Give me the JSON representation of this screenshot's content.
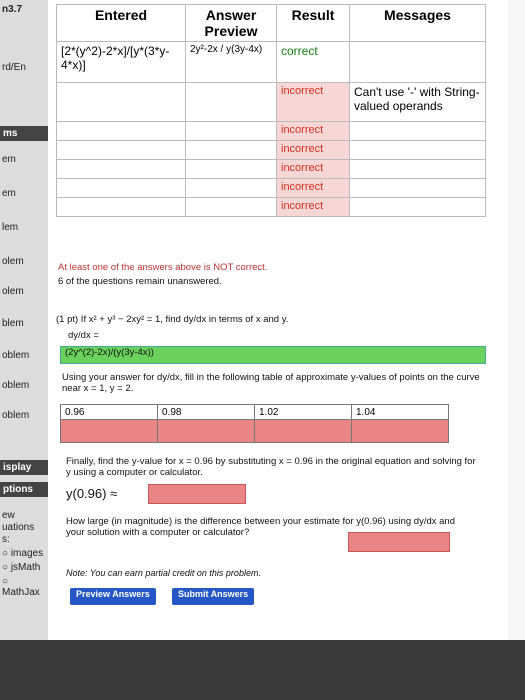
{
  "sidebar": {
    "top": "n3.7",
    "items": [
      "rd/En",
      "ms",
      "em",
      "em",
      "lem",
      "olem",
      "olem",
      "blem",
      "oblem",
      "oblem",
      "oblem"
    ],
    "display": "isplay",
    "options": "ptions",
    "misc": [
      "ew",
      "uations",
      "s:",
      "images",
      "jsMath",
      "MathJax"
    ]
  },
  "results": {
    "headers": [
      "Entered",
      "Answer Preview",
      "Result",
      "Messages"
    ],
    "row1": {
      "entered": "[2*(y^2)-2*x]/[y*(3*y-4*x)]",
      "preview": "2y²-2x / y(3y-4x)",
      "result": "correct",
      "message": ""
    },
    "row2": {
      "result": "incorrect",
      "message": "Can't use '-' with String-valued operands"
    },
    "row3": {
      "result": "incorrect"
    },
    "row4": {
      "result": "incorrect"
    },
    "row5": {
      "result": "incorrect"
    },
    "row6": {
      "result": "incorrect"
    },
    "row7": {
      "result": "incorrect"
    }
  },
  "messages": {
    "not_correct": "At least one of the answers above is NOT correct.",
    "unanswered": "6 of the questions remain unanswered."
  },
  "problem": {
    "part1": "(1 pt) If x² + y³ − 2xy² = 1, find dy/dx in terms of x and y.",
    "dydx_label": "dy/dx =",
    "answer1": "(2y^(2)-2x)/(y(3y-4x))",
    "instruction": "Using your answer for dy/dx, fill in the following table of approximate y-values of points on the curve near x = 1, y = 2.",
    "table_x": [
      "0.96",
      "0.98",
      "1.02",
      "1.04"
    ],
    "finally": "Finally, find the y-value for x = 0.96 by substituting x = 0.96 in the original equation and solving for y using a computer or calculator.",
    "y096": "y(0.96) ≈",
    "how_large": "How large (in magnitude) is the difference between your estimate for y(0.96) using dy/dx and your solution with a computer or calculator?",
    "note": "Note: You can earn partial credit on this problem."
  },
  "buttons": {
    "preview": "Preview Answers",
    "submit": "Submit Answers"
  }
}
